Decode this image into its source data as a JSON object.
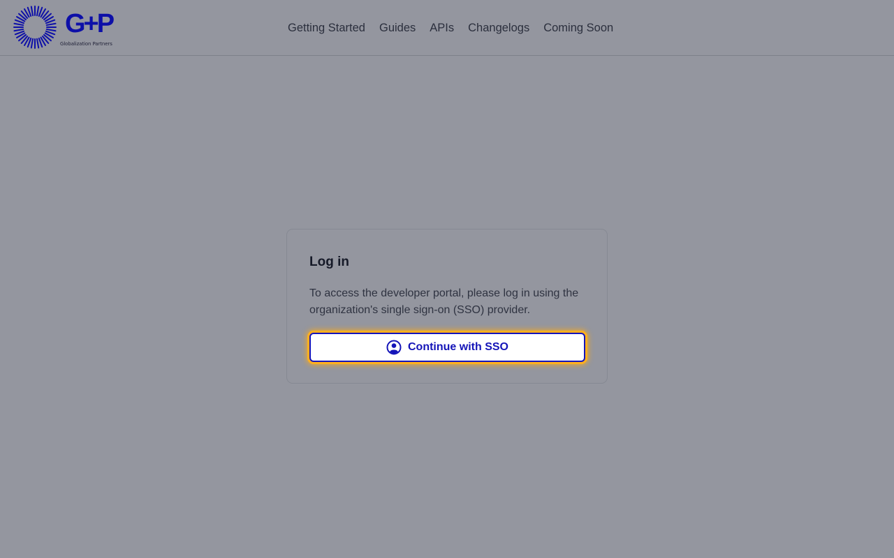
{
  "header": {
    "logo": {
      "letters": "G+P",
      "subtitle": "Globalization Partners",
      "color": "#0d0fa8"
    },
    "nav": [
      {
        "label": "Getting Started"
      },
      {
        "label": "Guides"
      },
      {
        "label": "APIs"
      },
      {
        "label": "Changelogs"
      },
      {
        "label": "Coming Soon"
      }
    ]
  },
  "login": {
    "title": "Log in",
    "description": "To access the developer portal, please log in using the organization's single sign-on (SSO) provider.",
    "sso_button": {
      "label": "Continue with SSO",
      "icon": "user-circle-icon",
      "accent": "#1414b8",
      "focus_ring": "#ffb01f"
    }
  }
}
